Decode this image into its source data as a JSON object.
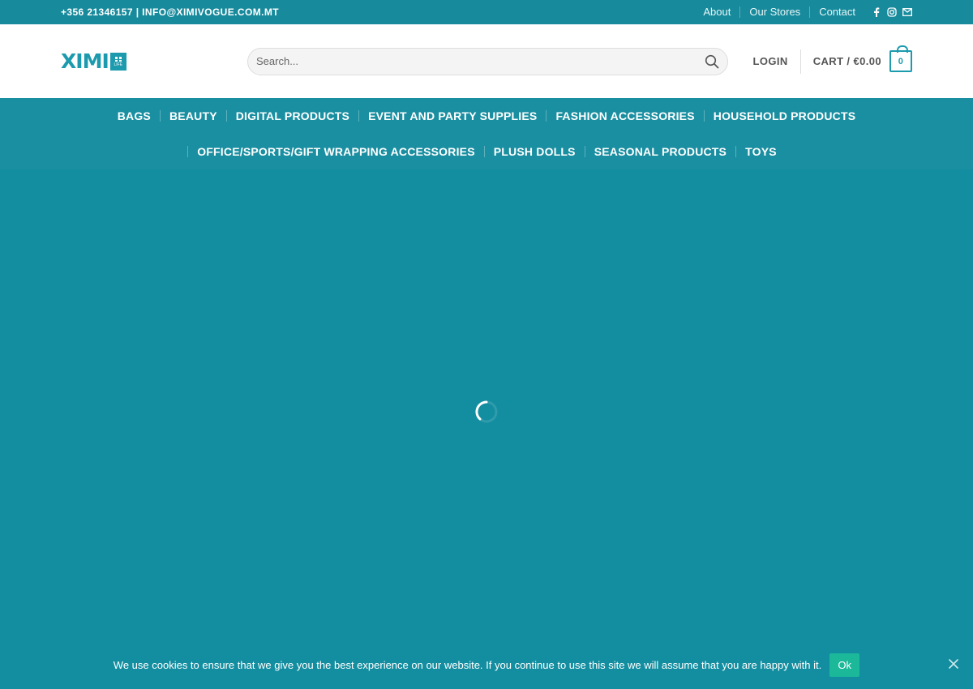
{
  "topbar": {
    "contact": "+356 21346157 | INFO@XIMIVOGUE.COM.MT",
    "links": [
      "About",
      "Our Stores",
      "Contact"
    ],
    "social_icons": [
      "facebook-icon",
      "instagram-icon",
      "email-icon"
    ]
  },
  "header": {
    "logo_text": "XIMI",
    "logo_tag": "LIFE",
    "search_placeholder": "Search...",
    "login_label": "LOGIN",
    "cart_label": "CART / €0.00",
    "cart_count": "0"
  },
  "categories": {
    "row1": [
      "BAGS",
      "BEAUTY",
      "DIGITAL PRODUCTS",
      "EVENT AND PARTY SUPPLIES",
      "FASHION ACCESSORIES",
      "HOUSEHOLD PRODUCTS"
    ],
    "row2": [
      "OFFICE/SPORTS/GIFT WRAPPING ACCESSORIES",
      "PLUSH DOLLS",
      "SEASONAL PRODUCTS",
      "TOYS"
    ]
  },
  "cookie": {
    "message": "We use cookies to ensure that we give you the best experience on our website. If you continue to use this site we will assume that you are happy with it.",
    "ok_label": "Ok"
  },
  "colors": {
    "brand": "#1c9aae",
    "topbar": "#178a9c",
    "background": "#138ea0",
    "ok_button": "#1bb89a"
  }
}
